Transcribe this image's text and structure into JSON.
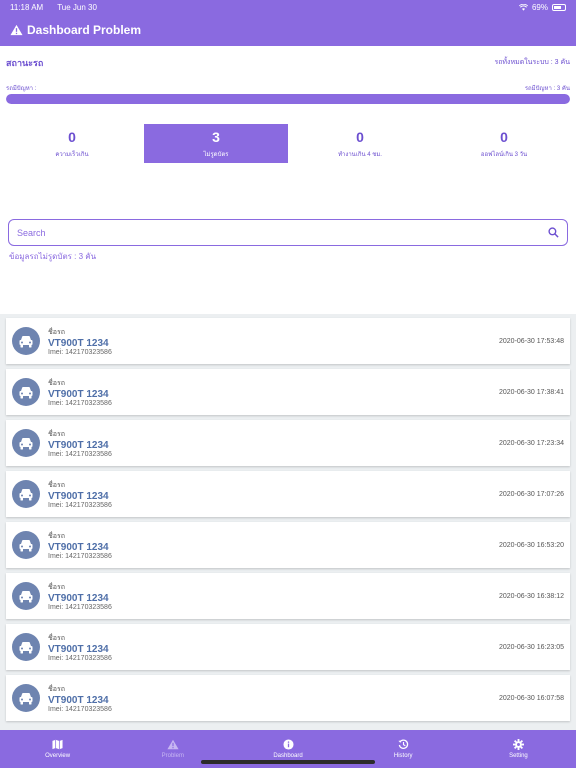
{
  "status_bar": {
    "time": "11:18 AM",
    "date": "Tue Jun 30",
    "battery": "69%",
    "battery_level": 0.69
  },
  "header": {
    "title": "Dashboard Problem"
  },
  "summary": {
    "section_title": "สถานะรถ",
    "total_text": "รถทั้งหมดในระบบ : 3 คัน",
    "problem_left_label": "รถมีปัญหา :",
    "problem_right_label": "รถมีปัญหา : 3 คัน",
    "problem_ratio": 1.0
  },
  "stats": [
    {
      "value": "0",
      "label": "ความเร็วเกิน"
    },
    {
      "value": "3",
      "label": "ไม่รูดบัตร",
      "active": true
    },
    {
      "value": "0",
      "label": "ทำงานเกิน 4 ชม."
    },
    {
      "value": "0",
      "label": "ออฟไลน์เกิน 3 วัน"
    }
  ],
  "search": {
    "placeholder": "Search"
  },
  "list_info": "ข้อมูลรถไม่รูดบัตร : 3 คัน",
  "vehicles": [
    {
      "caption": "ชื่อรถ",
      "name": "VT900T 1234",
      "imei": "Imei: 142170323586",
      "time": "2020-06-30 17:53:48"
    },
    {
      "caption": "ชื่อรถ",
      "name": "VT900T 1234",
      "imei": "Imei: 142170323586",
      "time": "2020-06-30 17:38:41"
    },
    {
      "caption": "ชื่อรถ",
      "name": "VT900T 1234",
      "imei": "Imei: 142170323586",
      "time": "2020-06-30 17:23:34"
    },
    {
      "caption": "ชื่อรถ",
      "name": "VT900T 1234",
      "imei": "Imei: 142170323586",
      "time": "2020-06-30 17:07:26"
    },
    {
      "caption": "ชื่อรถ",
      "name": "VT900T 1234",
      "imei": "Imei: 142170323586",
      "time": "2020-06-30 16:53:20"
    },
    {
      "caption": "ชื่อรถ",
      "name": "VT900T 1234",
      "imei": "Imei: 142170323586",
      "time": "2020-06-30 16:38:12"
    },
    {
      "caption": "ชื่อรถ",
      "name": "VT900T 1234",
      "imei": "Imei: 142170323586",
      "time": "2020-06-30 16:23:05"
    },
    {
      "caption": "ชื่อรถ",
      "name": "VT900T 1234",
      "imei": "Imei: 142170323586",
      "time": "2020-06-30 16:07:58"
    }
  ],
  "tabs": [
    {
      "label": "Overview",
      "icon": "map-icon"
    },
    {
      "label": "Problem",
      "icon": "warning-icon",
      "selected": true
    },
    {
      "label": "Dashboard",
      "icon": "info-icon"
    },
    {
      "label": "History",
      "icon": "history-icon"
    },
    {
      "label": "Setting",
      "icon": "gear-icon"
    }
  ],
  "colors": {
    "primary": "#8a6ae0",
    "accent_text": "#6c4fd0",
    "vehicle_name": "#4f6fa8",
    "avatar": "#6e84b0"
  }
}
